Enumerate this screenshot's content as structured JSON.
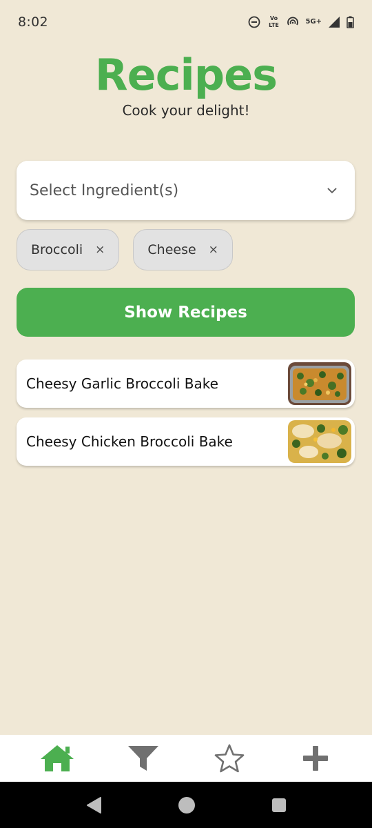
{
  "status_bar": {
    "time": "8:02",
    "volte_label": "Vo LTE",
    "network_label": "5G+"
  },
  "header": {
    "title": "Recipes",
    "subtitle": "Cook your delight!"
  },
  "ingredient_select": {
    "placeholder": "Select Ingredient(s)"
  },
  "selected_ingredients": [
    {
      "label": "Broccoli",
      "remove_symbol": "×"
    },
    {
      "label": "Cheese",
      "remove_symbol": "×"
    }
  ],
  "actions": {
    "show_recipes_label": "Show Recipes"
  },
  "recipes": [
    {
      "name": "Cheesy Garlic Broccoli Bake",
      "thumbnail_icon": "casserole-photo"
    },
    {
      "name": "Cheesy Chicken Broccoli Bake",
      "thumbnail_icon": "chicken-bake-photo"
    }
  ],
  "bottom_nav": {
    "items": [
      "home-icon",
      "filter-icon",
      "star-icon",
      "plus-icon"
    ],
    "active": "home-icon"
  },
  "colors": {
    "brand_green": "#4caf50",
    "background": "#f0e8d6",
    "inactive_icon": "#707070"
  }
}
